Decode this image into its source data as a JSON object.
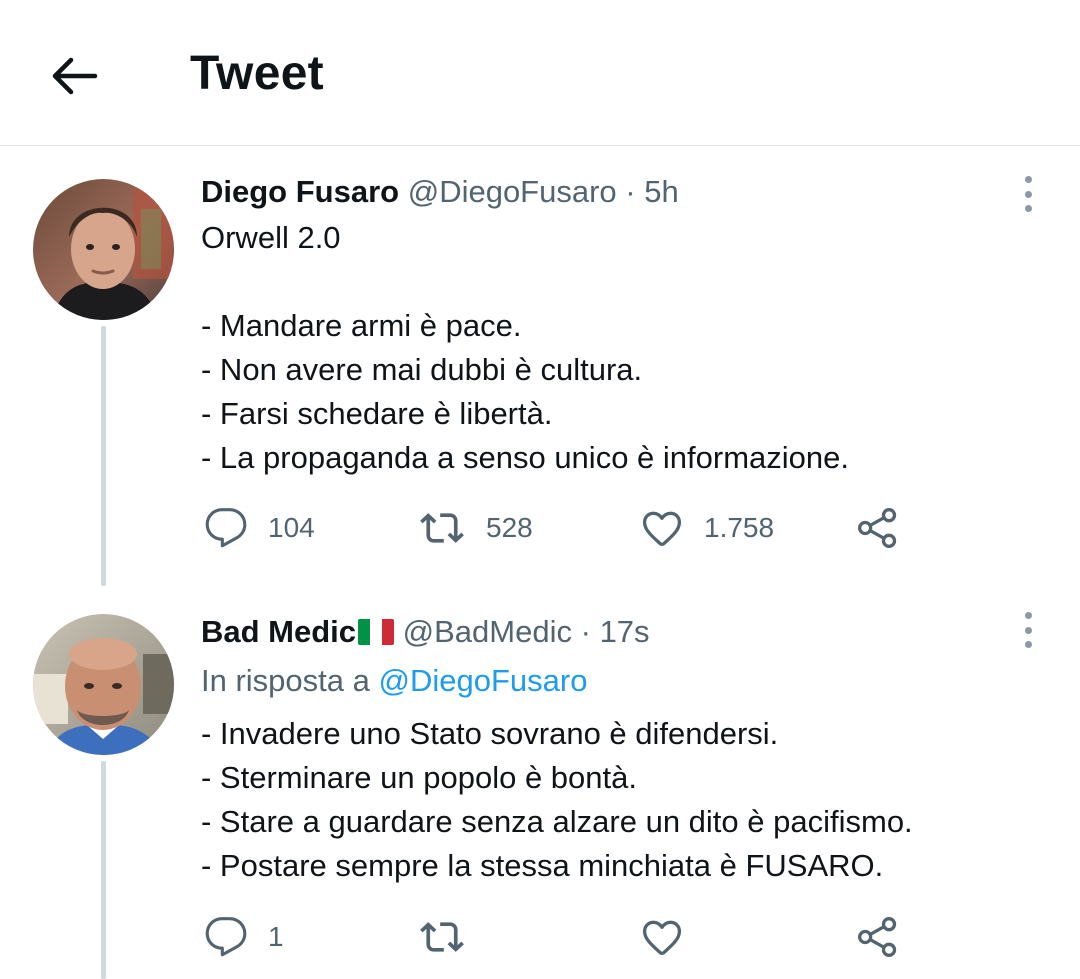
{
  "header": {
    "title": "Tweet",
    "back_icon": "arrow-left-icon"
  },
  "tweets": [
    {
      "author_name": "Diego Fusaro",
      "handle": "@DiegoFusaro",
      "separator": "·",
      "time": "5h",
      "lines": [
        "Orwell 2.0",
        "",
        "- Mandare armi è pace.",
        "- Non avere mai dubbi è cultura.",
        "- Farsi schedare è libertà.",
        "- La propaganda a senso unico è informazione."
      ],
      "replies": "104",
      "retweets": "528",
      "likes": "1.758"
    },
    {
      "author_name": "Bad Medic",
      "author_flag": "italy-flag-icon",
      "handle": "@BadMedic",
      "separator": "·",
      "time": "17s",
      "reply_prefix": "In risposta a ",
      "reply_handle": "@DiegoFusaro",
      "lines": [
        "- Invadere uno Stato sovrano è difendersi.",
        "- Sterminare un popolo è bontà.",
        "- Stare a guardare senza alzare un dito è pacifismo.",
        "- Postare sempre la stessa minchiata è FUSARO."
      ],
      "replies": "1",
      "retweets": "",
      "likes": ""
    }
  ],
  "colors": {
    "text_primary": "#0f1419",
    "text_secondary": "#536471",
    "link": "#1d9bf0",
    "thread_line": "#cfd9de",
    "divider": "#e1e6ea"
  }
}
